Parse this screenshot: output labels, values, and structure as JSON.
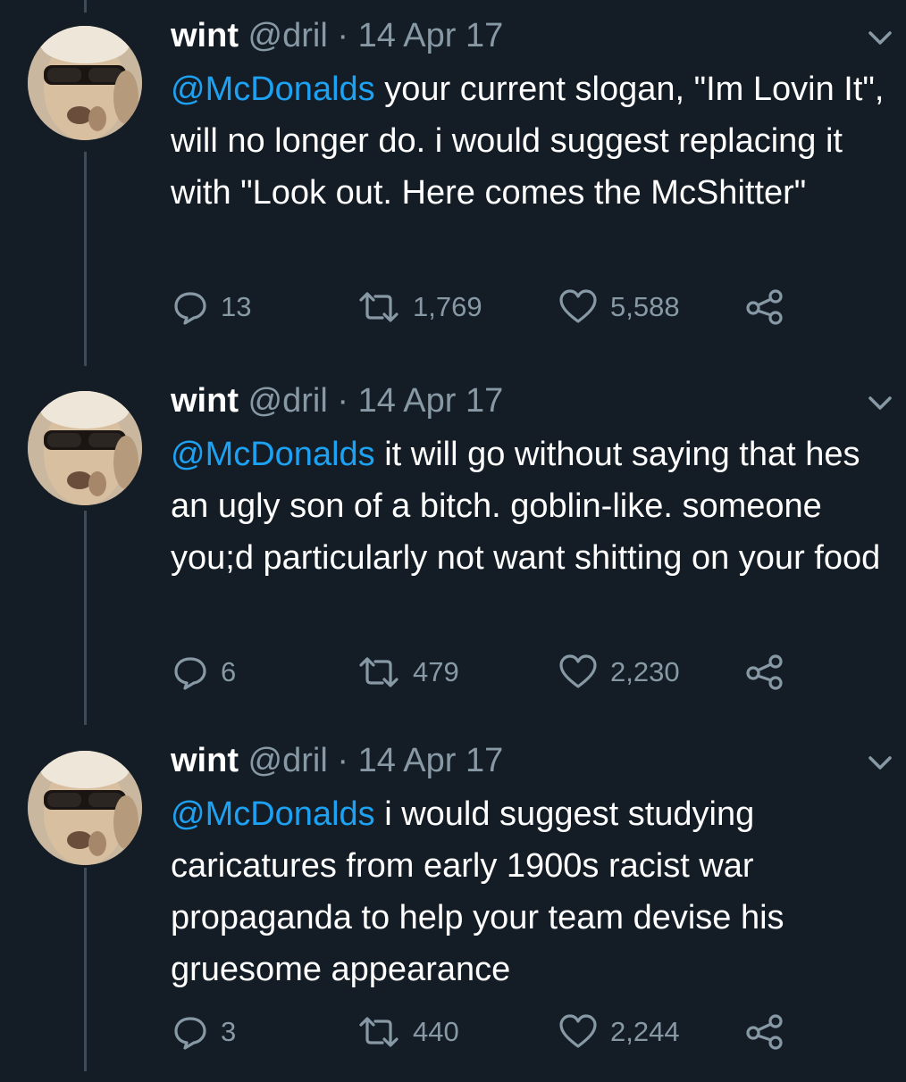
{
  "colors": {
    "background": "#141d26",
    "mention": "#1da1f2",
    "secondary_text": "#8899a6",
    "thread_line": "#3d4a57"
  },
  "tweets": [
    {
      "name": "wint",
      "handle": "@dril",
      "separator": "·",
      "date": "14 Apr 17",
      "mention": "@McDonalds",
      "text": " your current slogan, \"Im Lovin It\", will no longer do. i would suggest replacing it with \"Look out. Here comes the McShitter\"",
      "replies": "13",
      "retweets": "1,769",
      "likes": "5,588",
      "icons": [
        "reply-icon",
        "retweet-icon",
        "like-icon",
        "share-icon",
        "chevron-down-icon"
      ]
    },
    {
      "name": "wint",
      "handle": "@dril",
      "separator": "·",
      "date": "14 Apr 17",
      "mention": "@McDonalds",
      "text": " it will go without saying that hes an ugly son of a bitch. goblin-like. someone you;d particularly not want shitting on your food",
      "replies": "6",
      "retweets": "479",
      "likes": "2,230",
      "icons": [
        "reply-icon",
        "retweet-icon",
        "like-icon",
        "share-icon",
        "chevron-down-icon"
      ]
    },
    {
      "name": "wint",
      "handle": "@dril",
      "separator": "·",
      "date": "14 Apr 17",
      "mention": "@McDonalds",
      "text": " i would suggest studying caricatures from early 1900s racist war propaganda to help your team devise his gruesome appearance",
      "replies": "3",
      "retweets": "440",
      "likes": "2,244",
      "icons": [
        "reply-icon",
        "retweet-icon",
        "like-icon",
        "share-icon",
        "chevron-down-icon"
      ]
    }
  ]
}
